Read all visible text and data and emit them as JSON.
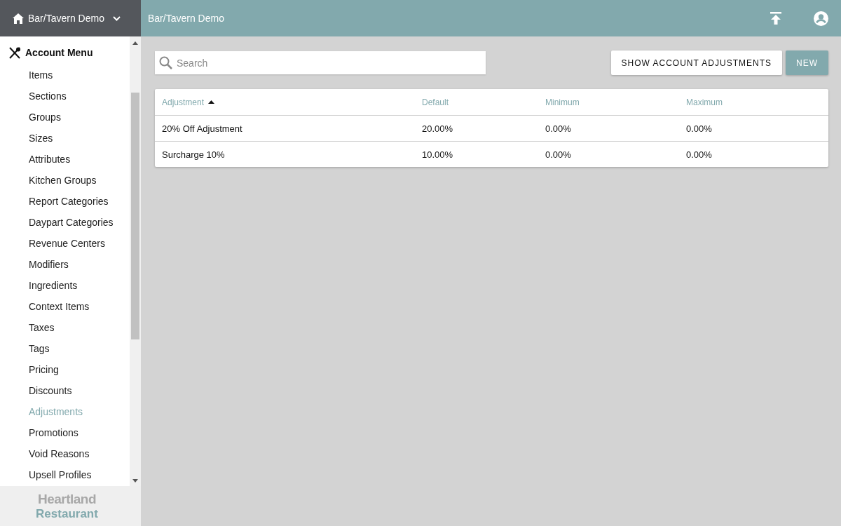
{
  "sidebar": {
    "account": "Bar/Tavern Demo",
    "menu_title": "Account Menu",
    "items": [
      {
        "label": "Items",
        "selected": false
      },
      {
        "label": "Sections",
        "selected": false
      },
      {
        "label": "Groups",
        "selected": false
      },
      {
        "label": "Sizes",
        "selected": false
      },
      {
        "label": "Attributes",
        "selected": false
      },
      {
        "label": "Kitchen Groups",
        "selected": false
      },
      {
        "label": "Report Categories",
        "selected": false
      },
      {
        "label": "Daypart Categories",
        "selected": false
      },
      {
        "label": "Revenue Centers",
        "selected": false
      },
      {
        "label": "Modifiers",
        "selected": false
      },
      {
        "label": "Ingredients",
        "selected": false
      },
      {
        "label": "Context Items",
        "selected": false
      },
      {
        "label": "Taxes",
        "selected": false
      },
      {
        "label": "Tags",
        "selected": false
      },
      {
        "label": "Pricing",
        "selected": false
      },
      {
        "label": "Discounts",
        "selected": false
      },
      {
        "label": "Adjustments",
        "selected": true
      },
      {
        "label": "Promotions",
        "selected": false
      },
      {
        "label": "Void Reasons",
        "selected": false
      },
      {
        "label": "Upsell Profiles",
        "selected": false
      }
    ],
    "logo": {
      "line_1": "Heartland",
      "line_2": "Restaurant"
    }
  },
  "header": {
    "title": "Bar/Tavern Demo"
  },
  "search": {
    "placeholder": "Search"
  },
  "buttons": [
    {
      "label": "SHOW ACCOUNT ADJUSTMENTS",
      "kind": "secondary"
    },
    {
      "label": "NEW",
      "kind": "primary"
    }
  ],
  "table": {
    "columns": [
      {
        "label": "Adjustment",
        "sorted": true
      },
      {
        "label": "Default",
        "sorted": false
      },
      {
        "label": "Minimum",
        "sorted": false
      },
      {
        "label": "Maximum",
        "sorted": false
      }
    ],
    "rows": [
      [
        "20% Off Adjustment",
        "20.00%",
        "0.00%",
        "0.00%"
      ],
      [
        "Surcharge 10%",
        "10.00%",
        "0.00%",
        "0.00%"
      ]
    ]
  }
}
